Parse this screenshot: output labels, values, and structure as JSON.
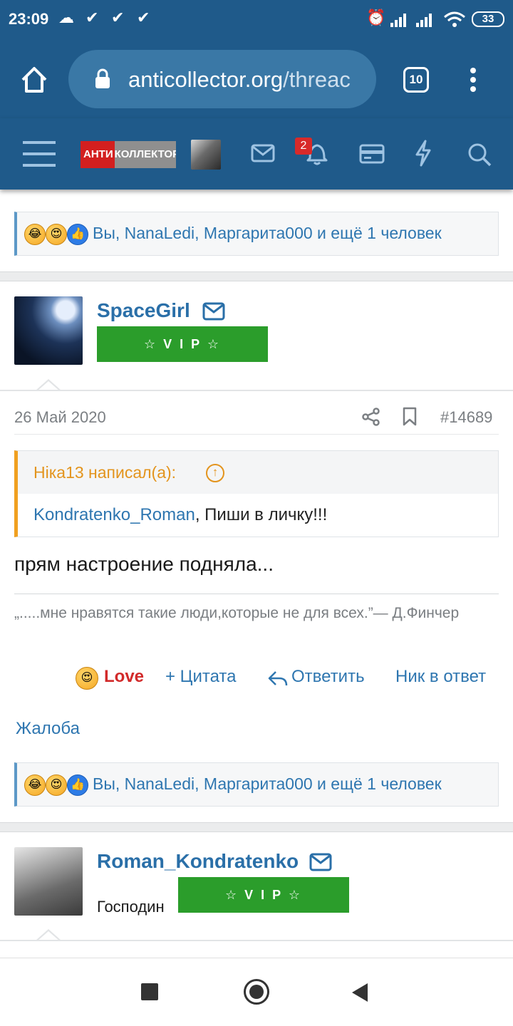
{
  "status_bar": {
    "time": "23:09",
    "battery": "33"
  },
  "browser": {
    "url_domain": "anticollector.org",
    "url_rest": "/threac",
    "tab_count": "10"
  },
  "site_header": {
    "logo_red": "АНТИ",
    "logo_gray": "КОЛЛЕКТОР",
    "notification_count": "2"
  },
  "reactions_bar_1": {
    "text": "Вы, NanaLedi, Маргарита000 и ещё 1 человек"
  },
  "post": {
    "username": "SpaceGirl",
    "badge": "☆ V I P ☆",
    "date": "26 Май 2020",
    "post_number": "#14689",
    "quote_author": "Ніка13 написал(а):",
    "quote_link": "Kondratenko_Roman",
    "quote_text": ", Пиши в личку!!!",
    "body": "прям настроение подняла...",
    "signature": "„.....мне нравятся такие люди,которые не для всех.”— Д.Финчер",
    "reaction_label": "Love",
    "actions": {
      "quote": "+ Цитата",
      "reply": "Ответить",
      "nick_reply": "Ник в ответ",
      "report": "Жалоба"
    }
  },
  "reactions_bar_2": {
    "text": "Вы, NanaLedi, Маргарита000 и ещё 1 человек"
  },
  "next_post": {
    "username": "Roman_Kondratenko",
    "title": "Господин",
    "badge": "☆ V I P ☆"
  },
  "colors": {
    "header_blue": "#1f5a8a",
    "link_blue": "#2e76b0",
    "vip_green": "#2b9d2b",
    "quote_orange": "#e3941d",
    "love_red": "#d22a2a"
  }
}
